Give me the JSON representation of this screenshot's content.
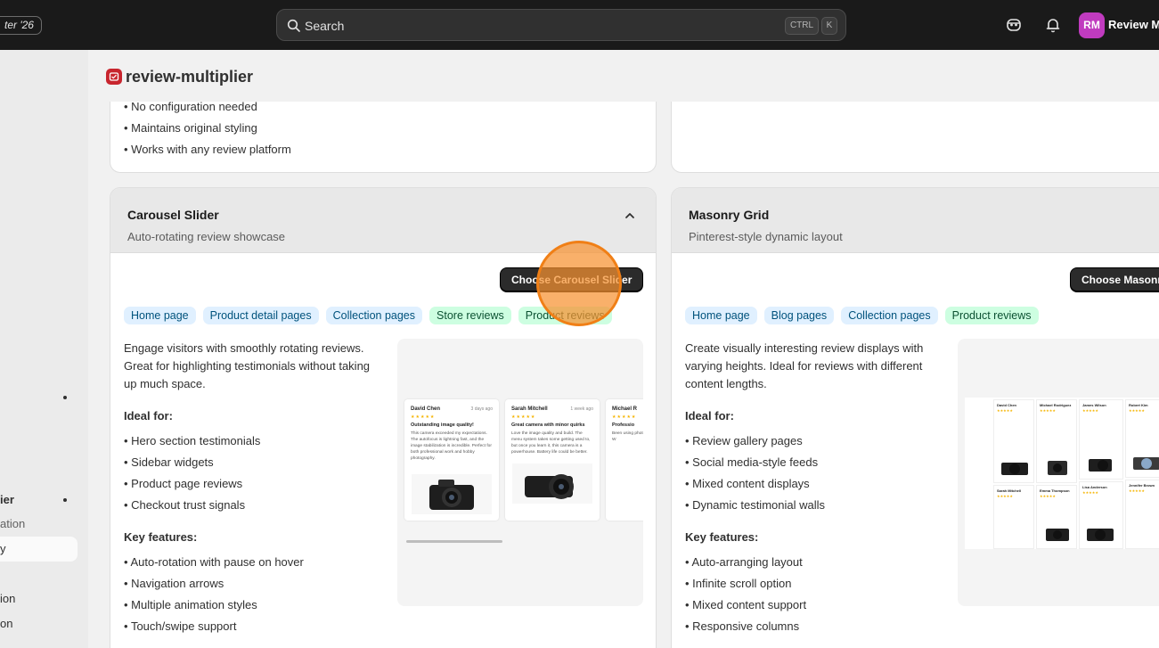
{
  "topbar": {
    "store_label": "ter '26",
    "search_placeholder": "Search",
    "shortcut_ctrl": "CTRL",
    "shortcut_k": "K",
    "user_initials": "RM",
    "user_name": "Review Mu"
  },
  "sidebar": {
    "items": [
      "ier",
      "ation",
      "y",
      "ion",
      "on"
    ]
  },
  "app": {
    "name": "review-multiplier"
  },
  "top_left_card": {
    "bullets": [
      "No configuration needed",
      "Maintains original styling",
      "Works with any review platform"
    ]
  },
  "carousel": {
    "title": "Carousel Slider",
    "subtitle": "Auto-rotating review showcase",
    "button": "Choose Carousel Slider",
    "tags": [
      "Home page",
      "Product detail pages",
      "Collection pages",
      "Store reviews",
      "Product reviews"
    ],
    "description": "Engage visitors with smoothly rotating reviews. Great for highlighting testimonials without taking up much space.",
    "ideal_heading": "Ideal for:",
    "ideal": [
      "Hero section testimonials",
      "Sidebar widgets",
      "Product page reviews",
      "Checkout trust signals"
    ],
    "features_heading": "Key features:",
    "features": [
      "Auto-rotation with pause on hover",
      "Navigation arrows",
      "Multiple animation styles",
      "Touch/swipe support"
    ],
    "preview_reviews": [
      {
        "name": "David Chen",
        "date": "3 days ago",
        "stars": "★★★★★",
        "headline": "Outstanding image quality!",
        "text": "This camera exceeded my expectations. The autofocus is lightning fast, and the image stabilization is incredible. Perfect for both professional work and hobby photography."
      },
      {
        "name": "Sarah Mitchell",
        "date": "1 week ago",
        "stars": "★★★★★",
        "headline": "Great camera with minor quirks",
        "text": "Love the image quality and build. The menu system takes some getting used to, but once you learn it, this camera is a powerhouse. Battery life could be better."
      },
      {
        "name": "Michael R",
        "date": "",
        "stars": "★★★★★",
        "headline": "Professio",
        "text": "Been using photograph as a pro of mind. W"
      }
    ]
  },
  "masonry": {
    "title": "Masonry Grid",
    "subtitle": "Pinterest-style dynamic layout",
    "button": "Choose Masonry Grid",
    "tags": [
      "Home page",
      "Blog pages",
      "Collection pages",
      "Product reviews"
    ],
    "description": "Create visually interesting review displays with varying heights. Ideal for reviews with different content lengths.",
    "ideal_heading": "Ideal for:",
    "ideal": [
      "Review gallery pages",
      "Social media-style feeds",
      "Mixed content displays",
      "Dynamic testimonial walls"
    ],
    "features_heading": "Key features:",
    "features": [
      "Auto-arranging layout",
      "Infinite scroll option",
      "Mixed content support",
      "Responsive columns"
    ],
    "preview_names": [
      "David Chen",
      "Michael Rodriguez",
      "James Wilson",
      "Robert Kim",
      "Sarah Mitchell",
      "Emma Thompson",
      "Lisa Anderson",
      "Jennifer Brown"
    ]
  },
  "colors": {
    "accent_orange": "#f07f16",
    "tag_blue_bg": "#e0f0ff",
    "tag_green_bg": "#cdfee1",
    "brand_red": "#c8252e",
    "avatar": "#c03bbf"
  }
}
